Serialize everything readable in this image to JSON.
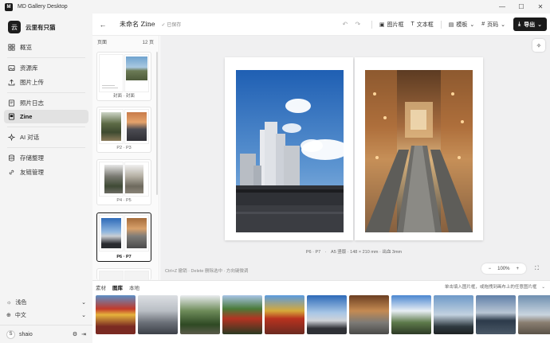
{
  "window": {
    "app_title": "MD Gallery Desktop",
    "logo": "M"
  },
  "brand": {
    "logo": "云",
    "name": "云里有只猫"
  },
  "nav": {
    "overview": "概览",
    "library": "资源库",
    "upload": "图片上传",
    "journal": "照片日志",
    "zine": "Zine",
    "ai_chat": "AI 对话",
    "storage": "存储整理",
    "links": "友链管理"
  },
  "settings": {
    "theme": "浅色",
    "language": "中文",
    "username": "shaio",
    "avatar_letter": "S"
  },
  "toolbar": {
    "title": "未命名 Zine",
    "saved": "✓ 已保存",
    "image_frame": "图片框",
    "text_frame": "文本框",
    "template": "模板",
    "page_number": "页码",
    "export": "导出"
  },
  "pages_panel": {
    "header": "页面",
    "count": "12 页",
    "items": [
      {
        "label": "封面 · 封面"
      },
      {
        "label": "P2 · P3"
      },
      {
        "label": "P4 · P5"
      },
      {
        "label": "P6 · P7"
      },
      {
        "label": ""
      }
    ]
  },
  "canvas": {
    "caption": "P6 · P7　·　A5 竖版 · 148 × 210 mm · 出血 3mm",
    "hint": "Ctrl+Z 撤销 · Delete 删除选中 · 方向键微调",
    "zoom": "100%"
  },
  "assets": {
    "tabs": [
      "素材",
      "图库",
      "本地"
    ],
    "active_tab": "图库",
    "hint": "单击填入图片框，或拖拽到画布上的任意图片框"
  },
  "colors": {
    "accent": "#1a1a1a",
    "sidebar_bg": "#f4f4f4",
    "canvas_bg": "#f0f0f1"
  }
}
